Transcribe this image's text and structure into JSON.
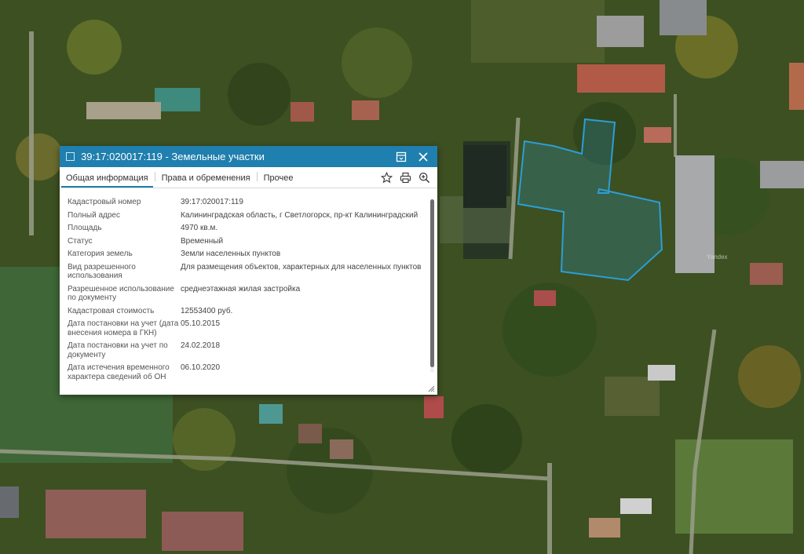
{
  "map": {
    "plot_outline_color": "#2a9fd6",
    "watermark": "Yandex"
  },
  "popup": {
    "title": "39:17:020017:119 - Земельные участки",
    "header_color": "#1f7fae",
    "icons": {
      "square": "square-icon",
      "print_map": "print-map-icon",
      "close": "close-icon",
      "favorite": "star-icon",
      "print": "printer-icon",
      "zoom": "zoom-in-icon"
    },
    "tabs": [
      "Общая информация",
      "Права и обременения",
      "Прочее"
    ],
    "active_tab": "Общая информация",
    "rows": [
      {
        "key": "Кадастровый номер",
        "value": "39:17:020017:119"
      },
      {
        "key": "Полный адрес",
        "value": "Калининградская область, г Светлогорск, пр-кт Калининградский"
      },
      {
        "key": "Площадь",
        "value": "4970 кв.м."
      },
      {
        "key": "Статус",
        "value": "Временный"
      },
      {
        "key": "Категория земель",
        "value": "Земли населенных пунктов"
      },
      {
        "key": "Вид разрешенного использования",
        "value": "Для размещения объектов, характерных для населенных пунктов"
      },
      {
        "key": "Разрешенное использование по документу",
        "value": "среднеэтажная жилая застройка"
      },
      {
        "key": "Кадастровая стоимость",
        "value": "12553400 руб."
      },
      {
        "key": "Дата постановки на учет (дата внесения номера в ГКН)",
        "value": "05.10.2015"
      },
      {
        "key": "Дата постановки на учет по документу",
        "value": "24.02.2018"
      },
      {
        "key": "Дата истечения временного характера сведений об ОН",
        "value": "06.10.2020"
      }
    ]
  }
}
